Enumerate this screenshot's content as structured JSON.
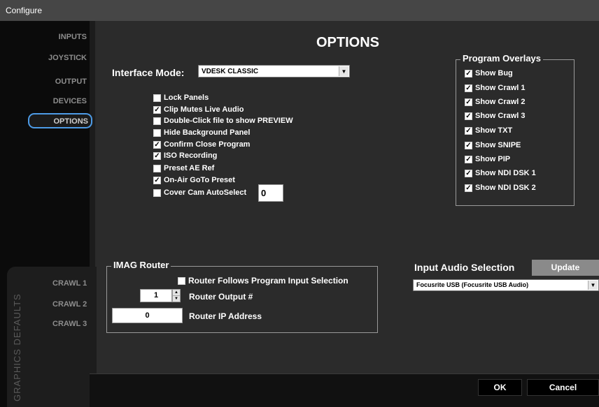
{
  "window": {
    "title": "Configure"
  },
  "sidebar": {
    "items": [
      {
        "label": "INPUTS"
      },
      {
        "label": "JOYSTICK"
      },
      {
        "label": "OUTPUT"
      },
      {
        "label": "DEVICES"
      },
      {
        "label": "OPTIONS",
        "active": true
      }
    ]
  },
  "graphics_defaults": {
    "title": "GRAPHICS DEFAULTS",
    "items": [
      {
        "label": "CRAWL 1"
      },
      {
        "label": "CRAWL 2"
      },
      {
        "label": "CRAWL 3"
      }
    ]
  },
  "page": {
    "title": "OPTIONS"
  },
  "interface_mode": {
    "label": "Interface Mode:",
    "value": "VDESK CLASSIC"
  },
  "options": [
    {
      "label": "Lock Panels",
      "checked": false
    },
    {
      "label": "Clip Mutes Live Audio",
      "checked": true
    },
    {
      "label": "Double-Click file to show PREVIEW",
      "checked": false
    },
    {
      "label": "Hide Background Panel",
      "checked": false
    },
    {
      "label": "Confirm Close Program",
      "checked": true
    },
    {
      "label": "ISO Recording",
      "checked": true
    },
    {
      "label": "Preset AE Ref",
      "checked": false
    },
    {
      "label": "On-Air GoTo Preset",
      "checked": true
    },
    {
      "label": "Cover Cam AutoSelect",
      "checked": false
    }
  ],
  "cover_cam_value": "0",
  "program_overlays": {
    "title": "Program Overlays",
    "items": [
      {
        "label": "Show Bug",
        "checked": true
      },
      {
        "label": "Show Crawl 1",
        "checked": true
      },
      {
        "label": "Show Crawl 2",
        "checked": true
      },
      {
        "label": "Show Crawl 3",
        "checked": true
      },
      {
        "label": "Show TXT",
        "checked": true
      },
      {
        "label": "Show SNIPE",
        "checked": true
      },
      {
        "label": "Show PIP",
        "checked": true
      },
      {
        "label": "Show NDI DSK 1",
        "checked": true
      },
      {
        "label": "Show NDI DSK 2",
        "checked": true
      }
    ]
  },
  "imag_router": {
    "title": "IMAG Router",
    "follows_label": "Router Follows Program Input Selection",
    "follows_checked": false,
    "output_label": "Router Output #",
    "output_value": "1",
    "ip_label": "Router IP Address",
    "ip_value": "0"
  },
  "input_audio": {
    "title": "Input Audio Selection",
    "update_label": "Update",
    "device": "Focusrite USB (Focusrite USB Audio)"
  },
  "footer": {
    "ok_label": "OK",
    "cancel_label": "Cancel"
  },
  "colors": {
    "active_border": "#4d9be6",
    "background": "#2b2b2b",
    "sidebar": "#0b0b0b"
  }
}
